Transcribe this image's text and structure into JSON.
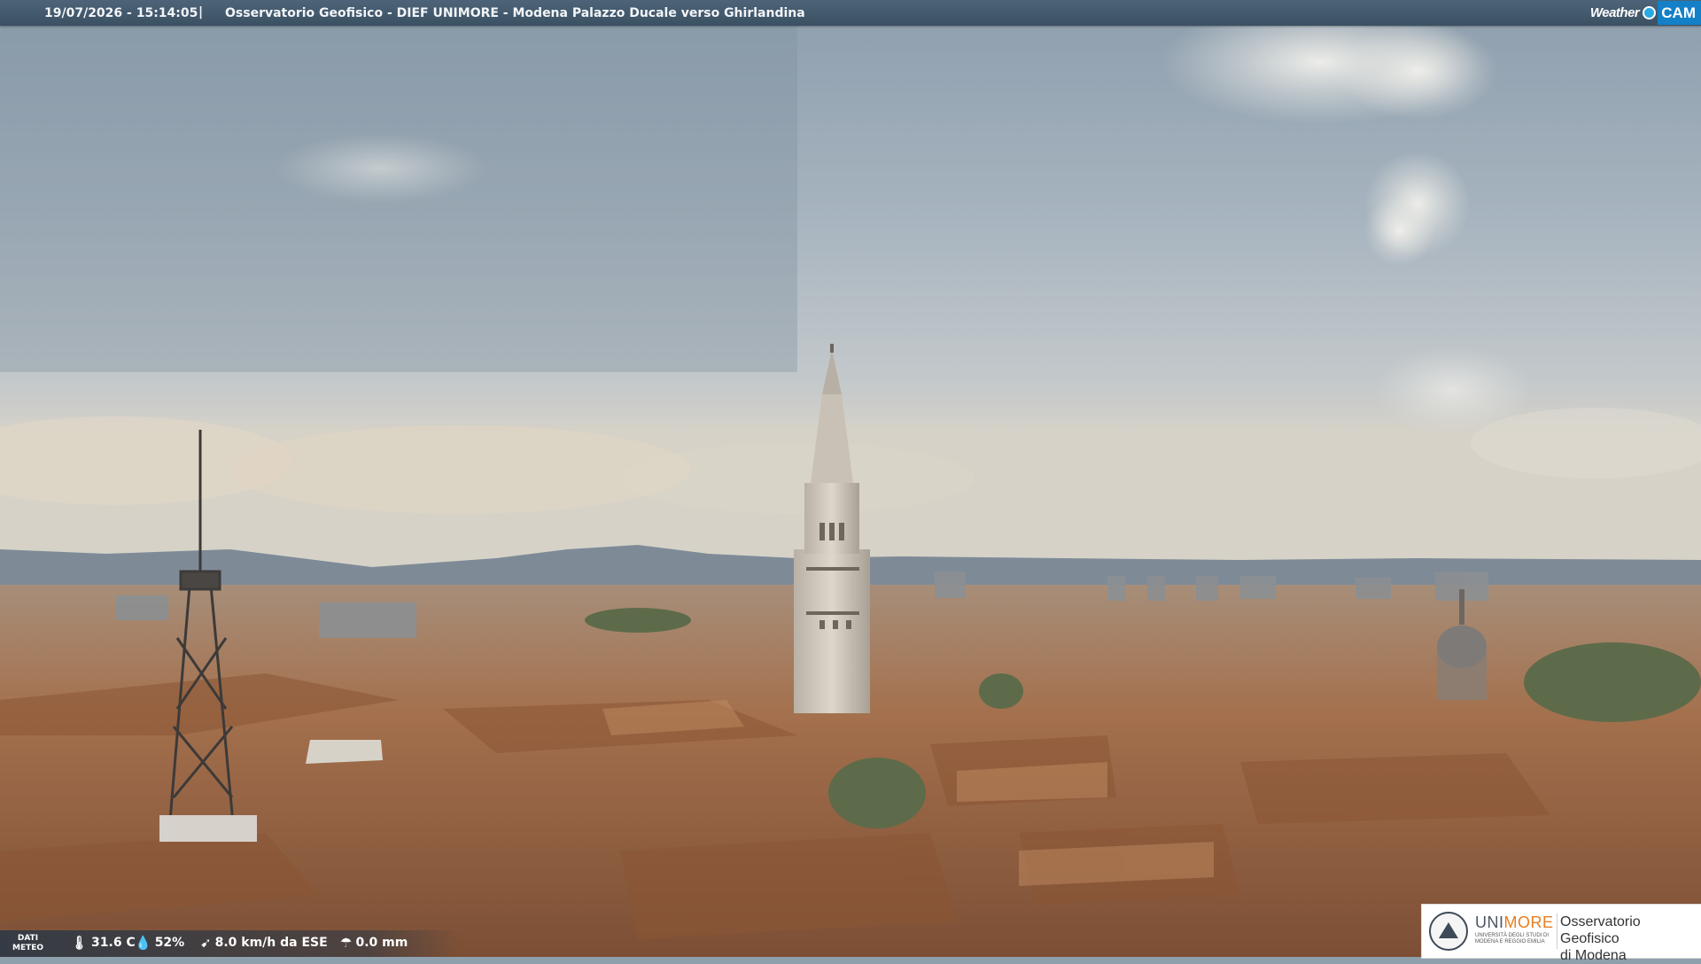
{
  "header": {
    "timestamp": "19/07/2026 - 15:14:05",
    "separator": "|",
    "title": "Osservatorio Geofisico - DIEF UNIMORE - Modena Palazzo Ducale verso Ghirlandina"
  },
  "brand": {
    "weather": "Weather",
    "cam": "CAM"
  },
  "meteo": {
    "label_line1": "DATI",
    "label_line2": "METEO",
    "temperature": "31.6 C",
    "humidity": "52%",
    "wind": "8.0 km/h da ESE",
    "rain": "0.0 mm"
  },
  "logo": {
    "uni_part1": "UNI",
    "uni_part2": "MORE",
    "uni_sub_line1": "UNIVERSITÀ DEGLI STUDI DI",
    "uni_sub_line2": "MODENA E REGGIO EMILIA",
    "org_line1": "Osservatorio Geofisico",
    "org_line2": "di Modena"
  },
  "colors": {
    "sky_top": "#9fb0bd",
    "sky_mid": "#b9c4cc",
    "haze": "#d7d6cf",
    "roofs": "#a86f4b",
    "tower": "#cfc7bb",
    "header_bar": "#4d6478",
    "accent_cam": "#1480c8",
    "accent_unimore": "#e67e22"
  }
}
